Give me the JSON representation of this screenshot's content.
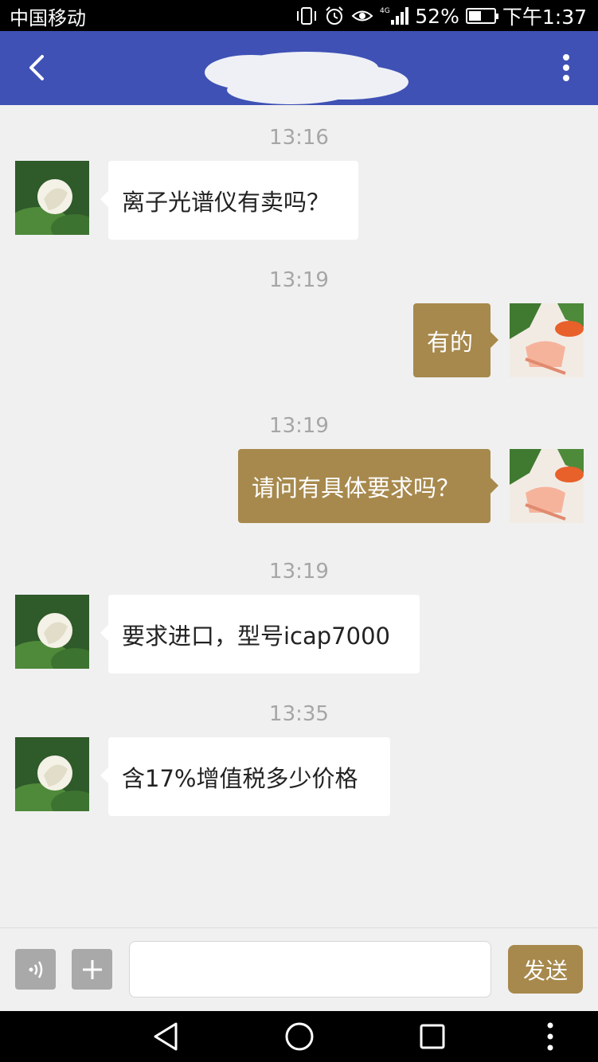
{
  "status_bar": {
    "carrier": "中国移动",
    "battery": "52%",
    "battery_level": 0.52,
    "network": "4G",
    "time": "下午1:37",
    "icons": [
      "vibrate-icon",
      "alarm-icon",
      "eye-icon",
      "signal-icon",
      "battery-icon"
    ]
  },
  "header": {
    "back_icon": "chevron-left-icon",
    "menu_icon": "more-vertical-icon"
  },
  "messages": [
    {
      "time": "13:16",
      "side": "in",
      "text": "离子光谱仪有卖吗？"
    },
    {
      "time": "13:19",
      "side": "out",
      "text": "有的"
    },
    {
      "time": "13:19",
      "side": "out",
      "text": "请问有具体要求吗？"
    },
    {
      "time": "13:19",
      "side": "in",
      "text": "要求进口，型号icap7000"
    },
    {
      "time": "13:35",
      "side": "in",
      "text": "含17%增值税多少价格"
    }
  ],
  "input_bar": {
    "voice_icon": "voice-icon",
    "plus_icon": "plus-icon",
    "input_value": "",
    "send_label": "发送"
  },
  "nav_bar": {
    "icons": [
      "back-triangle-icon",
      "home-circle-icon",
      "recents-square-icon",
      "more-vertical-icon"
    ]
  },
  "colors": {
    "header": "#3f51b5",
    "accent": "#a7894d",
    "background": "#f0f0f0"
  }
}
